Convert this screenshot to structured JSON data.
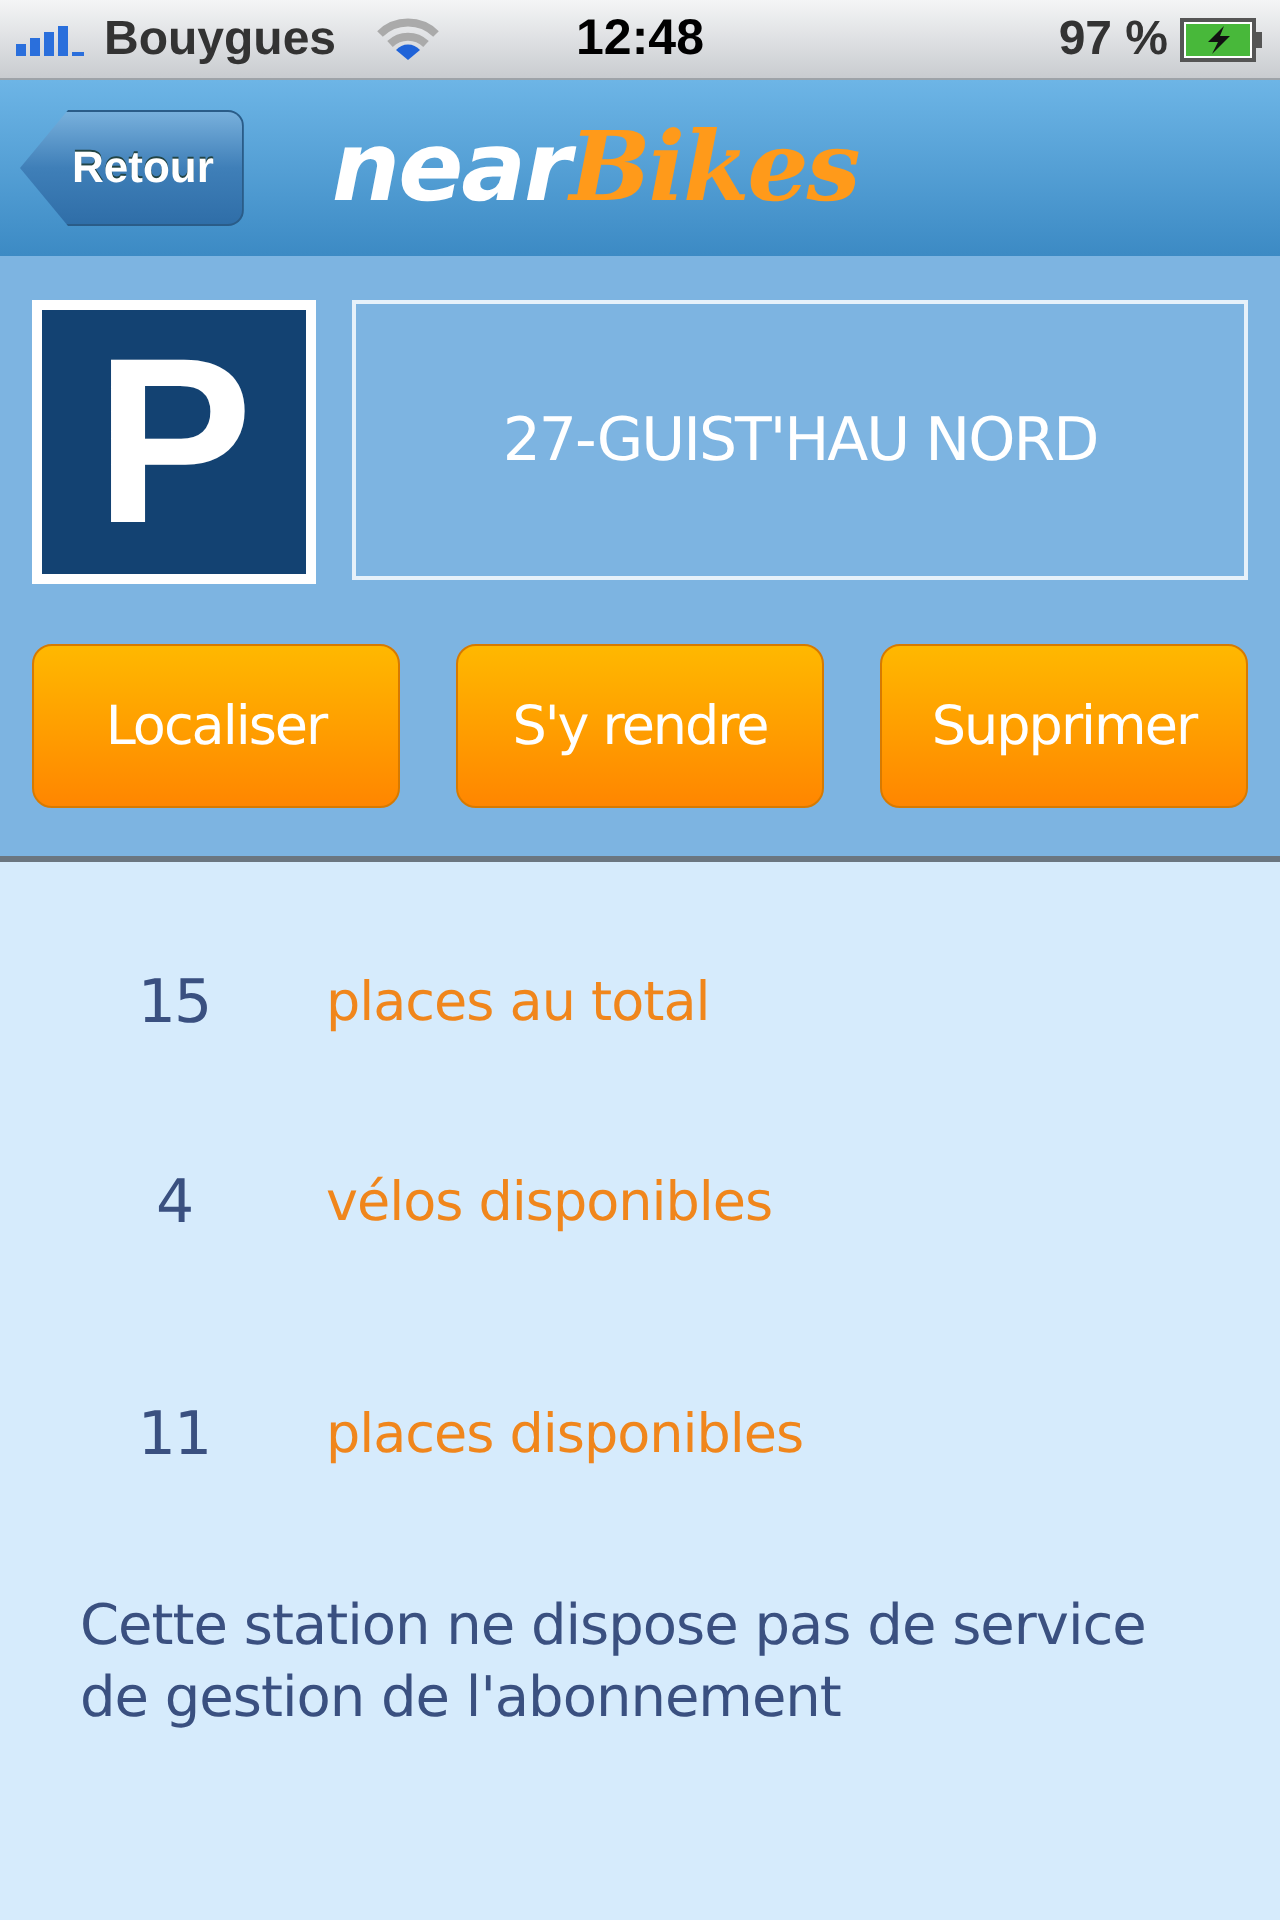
{
  "status_bar": {
    "carrier": "Bouygues",
    "time": "12:48",
    "battery": "97 %"
  },
  "nav_bar": {
    "back": "Retour",
    "logo": {
      "text_1": "near",
      "text_2": "Bikes"
    }
  },
  "station": {
    "sign": "P",
    "name": "27-GUIST'HAU NORD"
  },
  "actions": [
    "Localiser",
    "S'y rendre",
    "Supprimer"
  ],
  "stats": [
    {
      "value": "15",
      "label": "places au total"
    },
    {
      "value": "4",
      "label": "vélos disponibles"
    },
    {
      "value": "11",
      "label": "places disponibles"
    }
  ],
  "note": "Cette station ne dispose pas de service de gestion de l'abonnement"
}
